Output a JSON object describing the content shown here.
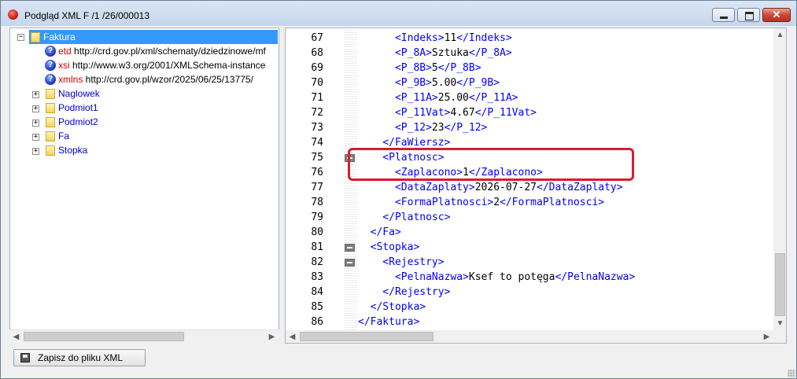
{
  "window": {
    "title": "Podgląd XML F /1  /26/000013",
    "buttons": {
      "minimize": "minimize",
      "maximize": "maximize",
      "close": "✕"
    }
  },
  "tree": {
    "root": {
      "label": "Faktura",
      "expanded": true
    },
    "attributes": [
      {
        "prefix": "etd",
        "value": " http://crd.gov.pl/xml/schematy/dziedzinowe/mf"
      },
      {
        "prefix": "xsi",
        "value": " http://www.w3.org/2001/XMLSchema-instance"
      },
      {
        "prefix": "xmlns",
        "value": " http://crd.gov.pl/wzor/2025/06/25/13775/"
      }
    ],
    "children": [
      {
        "label": "Naglowek"
      },
      {
        "label": "Podmiot1"
      },
      {
        "label": "Podmiot2"
      },
      {
        "label": "Fa"
      },
      {
        "label": "Stopka"
      }
    ]
  },
  "code": {
    "lines": [
      {
        "no": "67",
        "pre": "      <Indeks>",
        "val": "11",
        "post": "</Indeks>",
        "fold": false
      },
      {
        "no": "68",
        "pre": "      <P_8A>",
        "val": "Sztuka",
        "post": "</P_8A>",
        "fold": false
      },
      {
        "no": "69",
        "pre": "      <P_8B>",
        "val": "5",
        "post": "</P_8B>",
        "fold": false
      },
      {
        "no": "70",
        "pre": "      <P_9B>",
        "val": "5.00",
        "post": "</P_9B>",
        "fold": false
      },
      {
        "no": "71",
        "pre": "      <P_11A>",
        "val": "25.00",
        "post": "</P_11A>",
        "fold": false
      },
      {
        "no": "72",
        "pre": "      <P_11Vat>",
        "val": "4.67",
        "post": "</P_11Vat>",
        "fold": false
      },
      {
        "no": "73",
        "pre": "      <P_12>",
        "val": "23",
        "post": "</P_12>",
        "fold": false
      },
      {
        "no": "74",
        "pre": "    </FaWiersz>",
        "val": "",
        "post": "",
        "fold": false
      },
      {
        "no": "75",
        "pre": "    <Platnosc>",
        "val": "",
        "post": "",
        "fold": true
      },
      {
        "no": "76",
        "pre": "      <Zaplacono>",
        "val": "1",
        "post": "</Zaplacono>",
        "fold": false
      },
      {
        "no": "77",
        "pre": "      <DataZaplaty>",
        "val": "2026-07-27",
        "post": "</DataZaplaty>",
        "fold": false
      },
      {
        "no": "78",
        "pre": "      <FormaPlatnosci>",
        "val": "2",
        "post": "</FormaPlatnosci>",
        "fold": false
      },
      {
        "no": "79",
        "pre": "    </Platnosc>",
        "val": "",
        "post": "",
        "fold": false
      },
      {
        "no": "80",
        "pre": "  </Fa>",
        "val": "",
        "post": "",
        "fold": false
      },
      {
        "no": "81",
        "pre": "  <Stopka>",
        "val": "",
        "post": "",
        "fold": true
      },
      {
        "no": "82",
        "pre": "    <Rejestry>",
        "val": "",
        "post": "",
        "fold": true
      },
      {
        "no": "83",
        "pre": "      <PelnaNazwa>",
        "val": "Ksef to potęga",
        "post": "</PelnaNazwa>",
        "fold": false
      },
      {
        "no": "84",
        "pre": "    </Rejestry>",
        "val": "",
        "post": "",
        "fold": false
      },
      {
        "no": "85",
        "pre": "  </Stopka>",
        "val": "",
        "post": "",
        "fold": false
      },
      {
        "no": "86",
        "pre": "</Faktura>",
        "val": "",
        "post": "",
        "fold": false
      }
    ]
  },
  "footer": {
    "save_label": "Zapisz do pliku XML"
  },
  "colors": {
    "tag": "#0000ff",
    "highlight": "#d61e2d",
    "selection": "#3399ff"
  },
  "icons": {
    "app": "app-icon",
    "attribute": "question-icon",
    "node": "folder-icon",
    "save": "floppy-disk-icon"
  }
}
